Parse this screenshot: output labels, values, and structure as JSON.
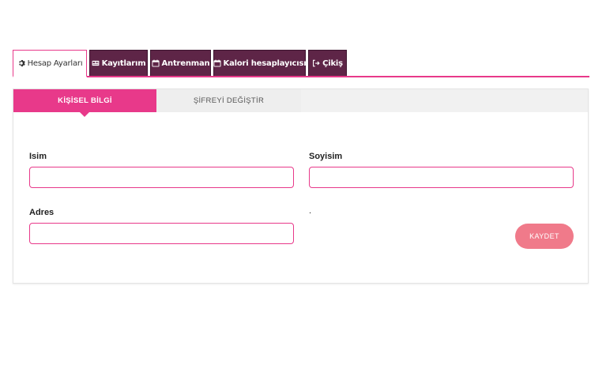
{
  "nav": {
    "tabs": [
      {
        "label": "Hesap Ayarları",
        "icon": "gear-icon",
        "active": true
      },
      {
        "label": "Kayıtlarım",
        "icon": "id-card-icon",
        "active": false
      },
      {
        "label": "Antrenman",
        "icon": "calendar-icon",
        "active": false
      },
      {
        "label": "Kalori hesaplayıcısı",
        "icon": "calendar-icon",
        "active": false
      },
      {
        "label": "Çikiş",
        "icon": "sign-out-icon",
        "active": false
      }
    ]
  },
  "subtabs": [
    {
      "label": "KİŞİSEL BİLGİ",
      "active": true
    },
    {
      "label": "ŞİFREYİ DEĞİŞTİR",
      "active": false
    }
  ],
  "form": {
    "first_name_label": "Isim",
    "first_name_value": "",
    "last_name_label": "Soyisim",
    "last_name_value": "",
    "address_label": "Adres",
    "address_value": "",
    "dot_text": ".",
    "save_label": "KAYDET"
  },
  "colors": {
    "accent": "#e8398a",
    "nav_tab_bg": "#5e2547",
    "save_button": "#f07a8a"
  }
}
